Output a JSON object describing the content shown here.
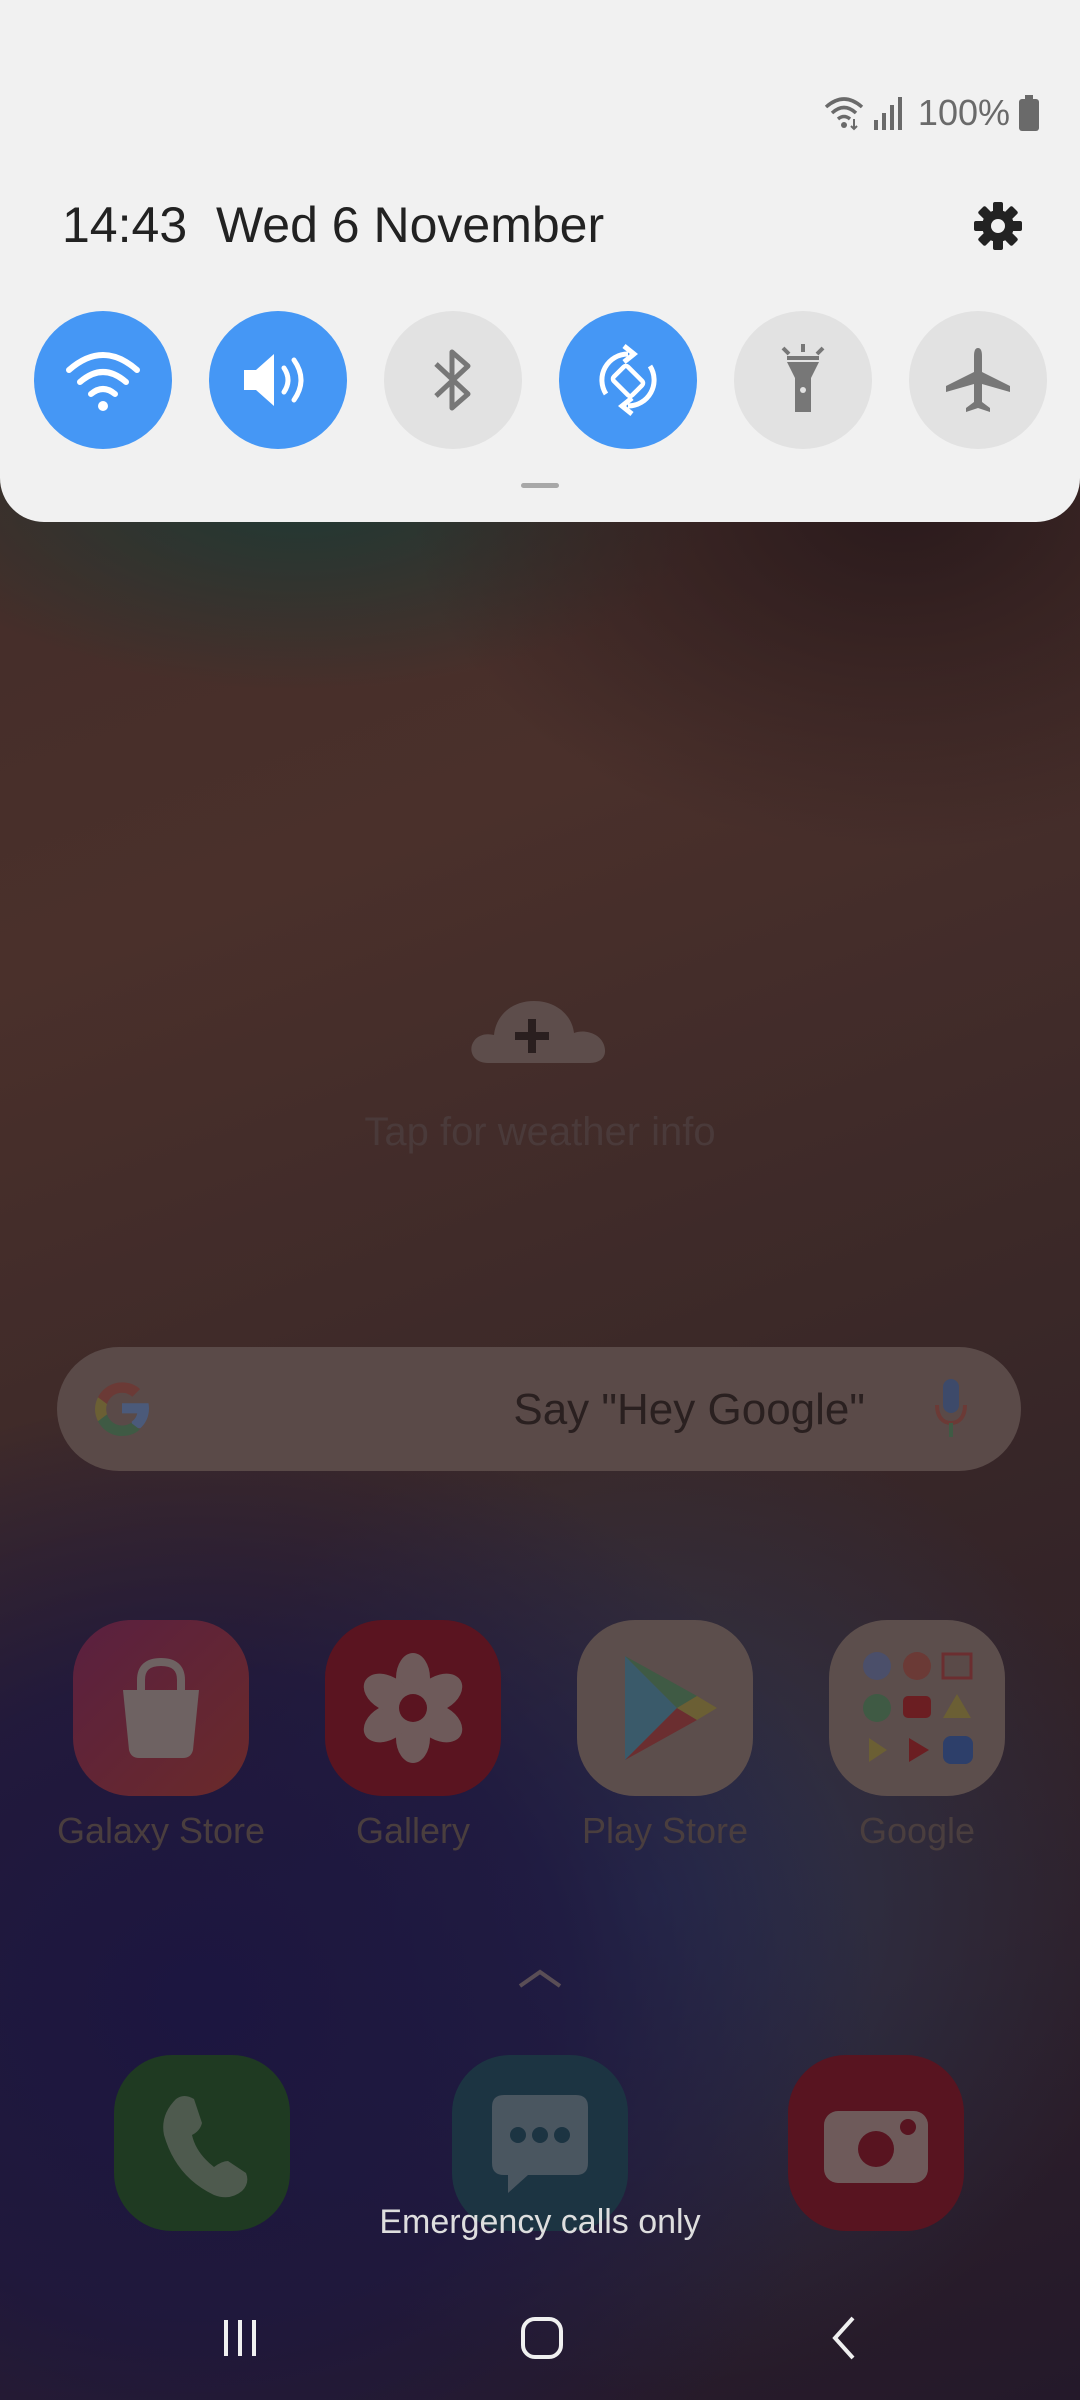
{
  "status_bar": {
    "battery_percent": "100%",
    "icons": [
      "wifi-icon",
      "signal-icon",
      "battery-icon"
    ]
  },
  "header": {
    "time": "14:43",
    "date": "Wed 6 November",
    "settings_icon": "gear-icon"
  },
  "quick_settings": [
    {
      "name": "wifi",
      "icon": "wifi-icon",
      "state": "on"
    },
    {
      "name": "sound",
      "icon": "volume-icon",
      "state": "on"
    },
    {
      "name": "bluetooth",
      "icon": "bluetooth-icon",
      "state": "off"
    },
    {
      "name": "auto-rotate",
      "icon": "rotate-icon",
      "state": "on"
    },
    {
      "name": "flashlight",
      "icon": "flashlight-icon",
      "state": "off"
    },
    {
      "name": "airplane-mode",
      "icon": "airplane-icon",
      "state": "off"
    }
  ],
  "weather": {
    "text": "Tap for weather info"
  },
  "search": {
    "placeholder": "Say \"Hey Google\""
  },
  "apps": [
    {
      "label": "Galaxy Store"
    },
    {
      "label": "Gallery"
    },
    {
      "label": "Play Store"
    },
    {
      "label": "Google"
    }
  ],
  "dock": [
    {
      "icon": "phone-icon"
    },
    {
      "icon": "messages-icon"
    },
    {
      "icon": "camera-icon"
    }
  ],
  "emergency_text": "Emergency calls only",
  "colors": {
    "accent": "#4597f5",
    "tile_off": "#e2e2e2",
    "shade_bg": "#f1f1f1"
  }
}
